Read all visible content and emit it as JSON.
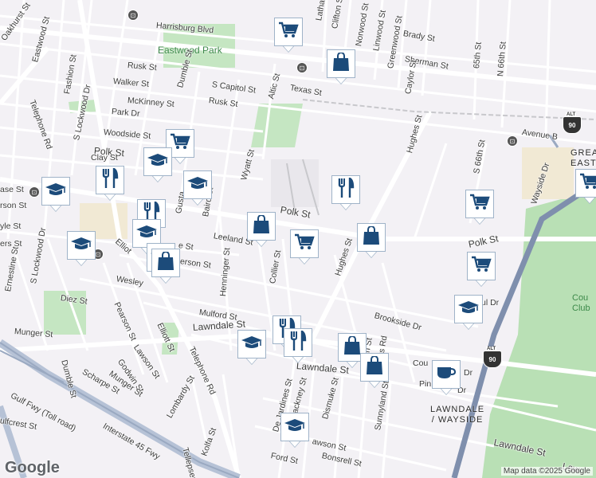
{
  "map": {
    "credit": "Map data ©2025 Google",
    "logo": "Google",
    "parks": [
      {
        "id": "eastwood-park",
        "label": "Eastwood Park"
      }
    ],
    "areas": [
      {
        "id": "lawndale-wayside",
        "line1": "LAWNDALE",
        "line2": "/ WAYSIDE"
      },
      {
        "id": "greater-east",
        "line1": "GREA",
        "line2": "EAST"
      }
    ],
    "golf": {
      "line1": "Cou",
      "line2": "Club"
    },
    "streets": [
      {
        "id": "harrisburg",
        "text": "Harrisburg Blvd"
      },
      {
        "id": "eastwood-st",
        "text": "Eastwood St"
      },
      {
        "id": "oakhurst",
        "text": "Oakhurst St"
      },
      {
        "id": "fashion",
        "text": "Fashion St"
      },
      {
        "id": "telephone-rd-n",
        "text": "Telephone Rd"
      },
      {
        "id": "rusk-w",
        "text": "Rusk St"
      },
      {
        "id": "walker",
        "text": "Walker St"
      },
      {
        "id": "mckinney",
        "text": "McKinney St"
      },
      {
        "id": "park-dr",
        "text": "Park Dr"
      },
      {
        "id": "woodside",
        "text": "Woodside St"
      },
      {
        "id": "polk-w",
        "text": "Polk St"
      },
      {
        "id": "clay",
        "text": "Clay St"
      },
      {
        "id": "lockwood-n",
        "text": "S Lockwood Dr"
      },
      {
        "id": "dumble-n",
        "text": "Dumble St"
      },
      {
        "id": "capitol",
        "text": "S Capitol St"
      },
      {
        "id": "rusk-c",
        "text": "Rusk St"
      },
      {
        "id": "altic",
        "text": "Altic St"
      },
      {
        "id": "texas",
        "text": "Texas St"
      },
      {
        "id": "latham",
        "text": "Latham"
      },
      {
        "id": "clifton",
        "text": "Clifton St"
      },
      {
        "id": "norwood",
        "text": "Norwood St"
      },
      {
        "id": "linwood",
        "text": "Linwood St"
      },
      {
        "id": "greenwood",
        "text": "Greenwood St"
      },
      {
        "id": "brady",
        "text": "Brady St"
      },
      {
        "id": "sherman",
        "text": "Sherman St"
      },
      {
        "id": "caylor",
        "text": "Caylor St"
      },
      {
        "id": "65th",
        "text": "65th St"
      },
      {
        "id": "n66th",
        "text": "N 66th St"
      },
      {
        "id": "avenue-b",
        "text": "Avenue B"
      },
      {
        "id": "hughes-n",
        "text": "Hughes St"
      },
      {
        "id": "s66th",
        "text": "S 66th St"
      },
      {
        "id": "wayside",
        "text": "Wayside Dr"
      },
      {
        "id": "wyatt",
        "text": "Wyatt St"
      },
      {
        "id": "polk-c",
        "text": "Polk St"
      },
      {
        "id": "polk-e",
        "text": "Polk St"
      },
      {
        "id": "baird",
        "text": "Baird St"
      },
      {
        "id": "gustav",
        "text": "Gusta"
      },
      {
        "id": "leeland",
        "text": "Leeland St"
      },
      {
        "id": "collier",
        "text": "Collier St"
      },
      {
        "id": "hughes-s",
        "text": "Hughes St"
      },
      {
        "id": "henninger",
        "text": "Henninger St"
      },
      {
        "id": "erson",
        "text": "erson St"
      },
      {
        "id": "e-st",
        "text": "e St"
      },
      {
        "id": "wesley",
        "text": "Wesley"
      },
      {
        "id": "elliott-n",
        "text": "Elliot"
      },
      {
        "id": "ase",
        "text": "ase St"
      },
      {
        "id": "rson",
        "text": "rson St"
      },
      {
        "id": "yle",
        "text": "yle St"
      },
      {
        "id": "ers",
        "text": "ers St"
      },
      {
        "id": "ernestine",
        "text": "Ernestine St"
      },
      {
        "id": "lockwood-s",
        "text": "S Lockwood Dr"
      },
      {
        "id": "diez",
        "text": "Diez St"
      },
      {
        "id": "pearson",
        "text": "Pearson St"
      },
      {
        "id": "elliott-s",
        "text": "Elliott St"
      },
      {
        "id": "lawson",
        "text": "Lawson St"
      },
      {
        "id": "munger-w",
        "text": "Munger St"
      },
      {
        "id": "godwin",
        "text": "Godwin St"
      },
      {
        "id": "dumble-s",
        "text": "Dumble St"
      },
      {
        "id": "scharpe",
        "text": "Scharpe St"
      },
      {
        "id": "munger-s",
        "text": "Munger St"
      },
      {
        "id": "telephone-rd-s",
        "text": "Telephone Rd"
      },
      {
        "id": "lombardy",
        "text": "Lombardy St"
      },
      {
        "id": "mulford",
        "text": "Mulford St"
      },
      {
        "id": "lawndale-w",
        "text": "Lawndale St"
      },
      {
        "id": "lawndale-c",
        "text": "Lawndale St"
      },
      {
        "id": "lawndale-e",
        "text": "Lawndale St"
      },
      {
        "id": "lawndale-far",
        "text": "Law"
      },
      {
        "id": "brookside",
        "text": "Brookside Dr"
      },
      {
        "id": "ul-dr",
        "text": "ul Dr"
      },
      {
        "id": "cou-dr",
        "text": "Cou"
      },
      {
        "id": "dr-2",
        "text": "Dr"
      },
      {
        "id": "pin-dr",
        "text": "Pin"
      },
      {
        "id": "dr-3",
        "text": "Dr"
      },
      {
        "id": "gulf-fwy",
        "text": "Gulf Fwy (Toll road)"
      },
      {
        "id": "ulfcrest",
        "text": "ulfcrest St"
      },
      {
        "id": "i45",
        "text": "Interstate 45 Fwy"
      },
      {
        "id": "tellepsen",
        "text": "Tellepsen St"
      },
      {
        "id": "kolfa",
        "text": "Kolfa St"
      },
      {
        "id": "dejardines",
        "text": "De Jardines St"
      },
      {
        "id": "hackney",
        "text": "Hackney St"
      },
      {
        "id": "dismuke",
        "text": "Dismuke St"
      },
      {
        "id": "sunnyland",
        "text": "Sunnyland St"
      },
      {
        "id": "awson",
        "text": "awson St"
      },
      {
        "id": "ford",
        "text": "Ford St"
      },
      {
        "id": "bonsrell",
        "text": "Bonsrell St"
      },
      {
        "id": "ks-rd",
        "text": "ks Rd"
      },
      {
        "id": "rn",
        "text": "rn St"
      }
    ],
    "highway_shields": [
      {
        "id": "alt90-n",
        "route": "90",
        "top": "ALT"
      },
      {
        "id": "alt90-s",
        "route": "90",
        "top": "ALT"
      }
    ],
    "pins": [
      {
        "id": "p1",
        "type": "grocery",
        "icon": "cart-icon"
      },
      {
        "id": "p2",
        "type": "shopping",
        "icon": "shopping-bag-icon"
      },
      {
        "id": "p3",
        "type": "grocery",
        "icon": "cart-icon"
      },
      {
        "id": "p4",
        "type": "school",
        "icon": "graduation-cap-icon"
      },
      {
        "id": "p5",
        "type": "restaurant",
        "icon": "fork-knife-icon"
      },
      {
        "id": "p6",
        "type": "grocery",
        "icon": "cart-icon"
      },
      {
        "id": "p7",
        "type": "school",
        "icon": "graduation-cap-icon"
      },
      {
        "id": "p8",
        "type": "school",
        "icon": "graduation-cap-icon"
      },
      {
        "id": "p9",
        "type": "shopping",
        "icon": "shopping-bag-icon"
      },
      {
        "id": "p10",
        "type": "grocery",
        "icon": "cart-icon"
      },
      {
        "id": "p11",
        "type": "shopping",
        "icon": "shopping-bag-icon"
      },
      {
        "id": "p12",
        "type": "grocery",
        "icon": "cart-icon"
      },
      {
        "id": "p13",
        "type": "school",
        "icon": "graduation-cap-icon"
      },
      {
        "id": "p14",
        "type": "school",
        "icon": "graduation-cap-icon"
      },
      {
        "id": "p15",
        "type": "restaurant",
        "icon": "fork-knife-icon"
      },
      {
        "id": "p16",
        "type": "restaurant",
        "icon": "fork-knife-icon"
      },
      {
        "id": "p17",
        "type": "school",
        "icon": "graduation-cap-icon"
      },
      {
        "id": "p18",
        "type": "school",
        "icon": "graduation-cap-icon"
      },
      {
        "id": "p19",
        "type": "shopping",
        "icon": "shopping-bag-icon"
      },
      {
        "id": "p20",
        "type": "school",
        "icon": "graduation-cap-icon"
      },
      {
        "id": "p21",
        "type": "restaurant",
        "icon": "fork-knife-icon"
      },
      {
        "id": "p22",
        "type": "restaurant",
        "icon": "fork-knife-icon"
      },
      {
        "id": "p23",
        "type": "shopping",
        "icon": "shopping-bag-icon"
      },
      {
        "id": "p24",
        "type": "shopping",
        "icon": "shopping-bag-icon"
      },
      {
        "id": "p25",
        "type": "cafe",
        "icon": "coffee-cup-icon"
      },
      {
        "id": "p26",
        "type": "school",
        "icon": "graduation-cap-icon"
      },
      {
        "id": "p27",
        "type": "grocery",
        "icon": "cart-icon"
      }
    ]
  }
}
